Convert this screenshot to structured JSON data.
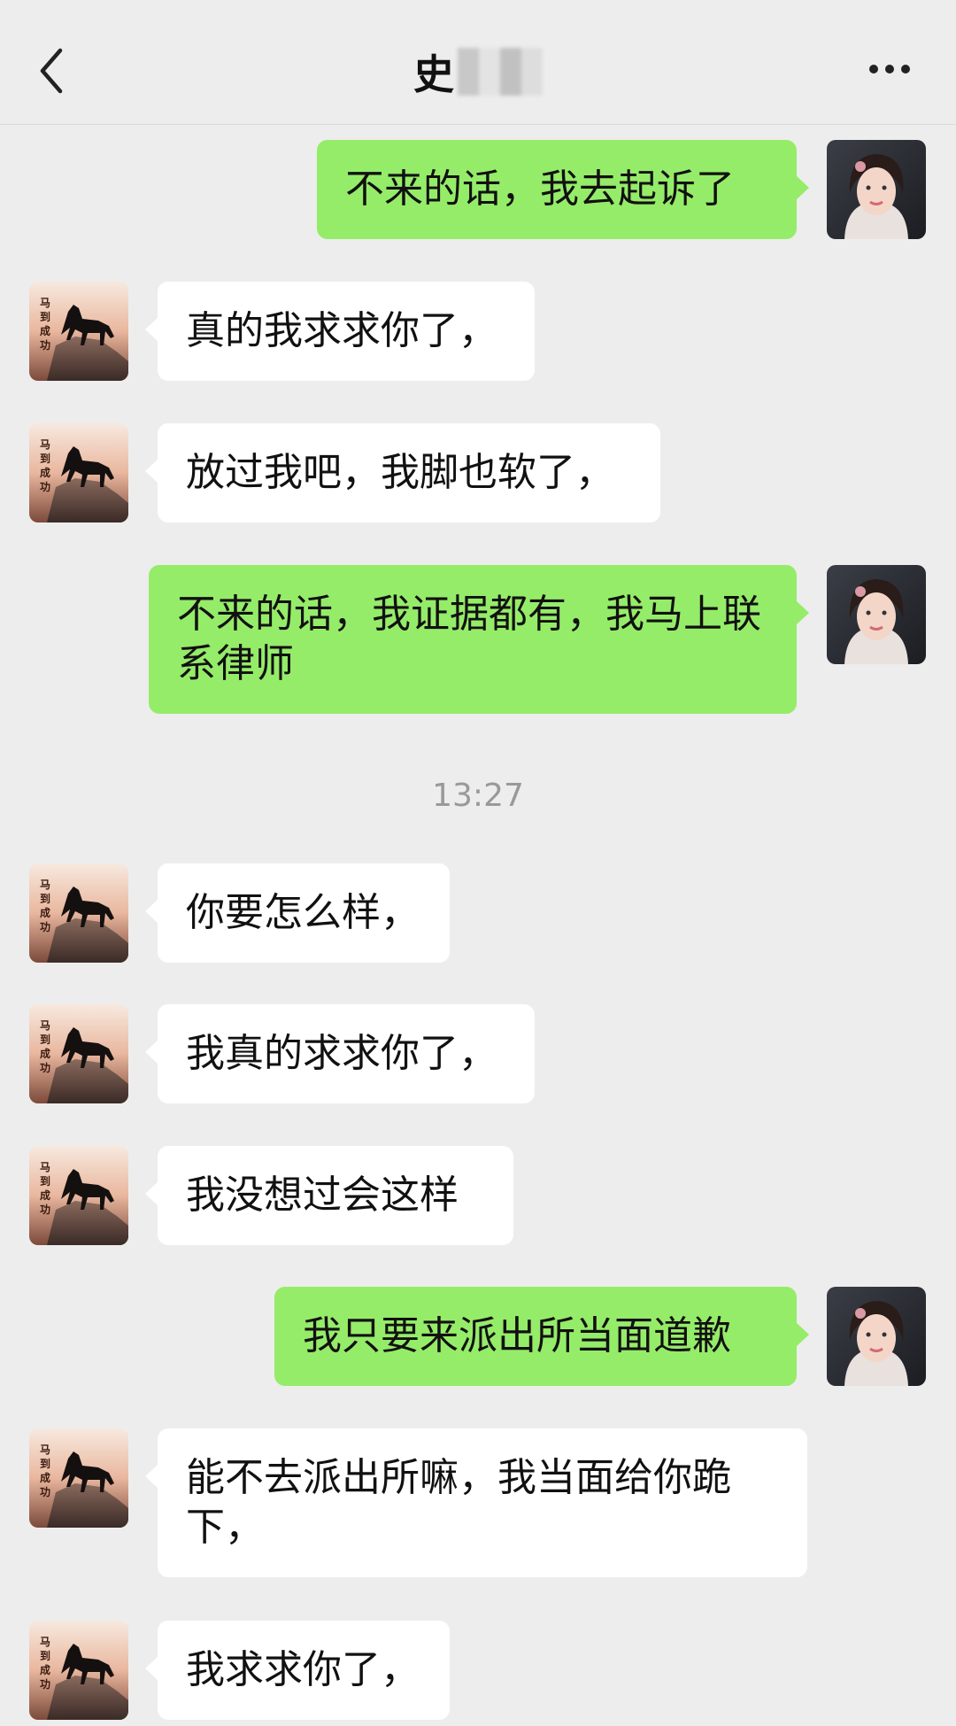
{
  "header": {
    "contact_name": "史",
    "back_icon": "chevron-left-icon",
    "more_icon": "ellipsis-icon"
  },
  "colors": {
    "background": "#ededed",
    "outgoing_bubble": "#95ec69",
    "incoming_bubble": "#ffffff",
    "timestamp_text": "#999999"
  },
  "avatars": {
    "contact_text": "马到成功"
  },
  "messages": [
    {
      "side": "out",
      "text": "不来的话，我去起诉了"
    },
    {
      "side": "in",
      "text": "真的我求求你了，"
    },
    {
      "side": "in",
      "text": "放过我吧，我脚也软了，"
    },
    {
      "side": "out",
      "text": "不来的话，我证据都有，我马上联系律师"
    },
    {
      "timestamp": "13:27"
    },
    {
      "side": "in",
      "text": "你要怎么样，"
    },
    {
      "side": "in",
      "text": "我真的求求你了，"
    },
    {
      "side": "in",
      "text": "我没想过会这样"
    },
    {
      "side": "out",
      "text": "我只要来派出所当面道歉"
    },
    {
      "side": "in",
      "text": "能不去派出所嘛，我当面给你跪下，"
    },
    {
      "side": "in",
      "text": "我求求你了，"
    }
  ]
}
